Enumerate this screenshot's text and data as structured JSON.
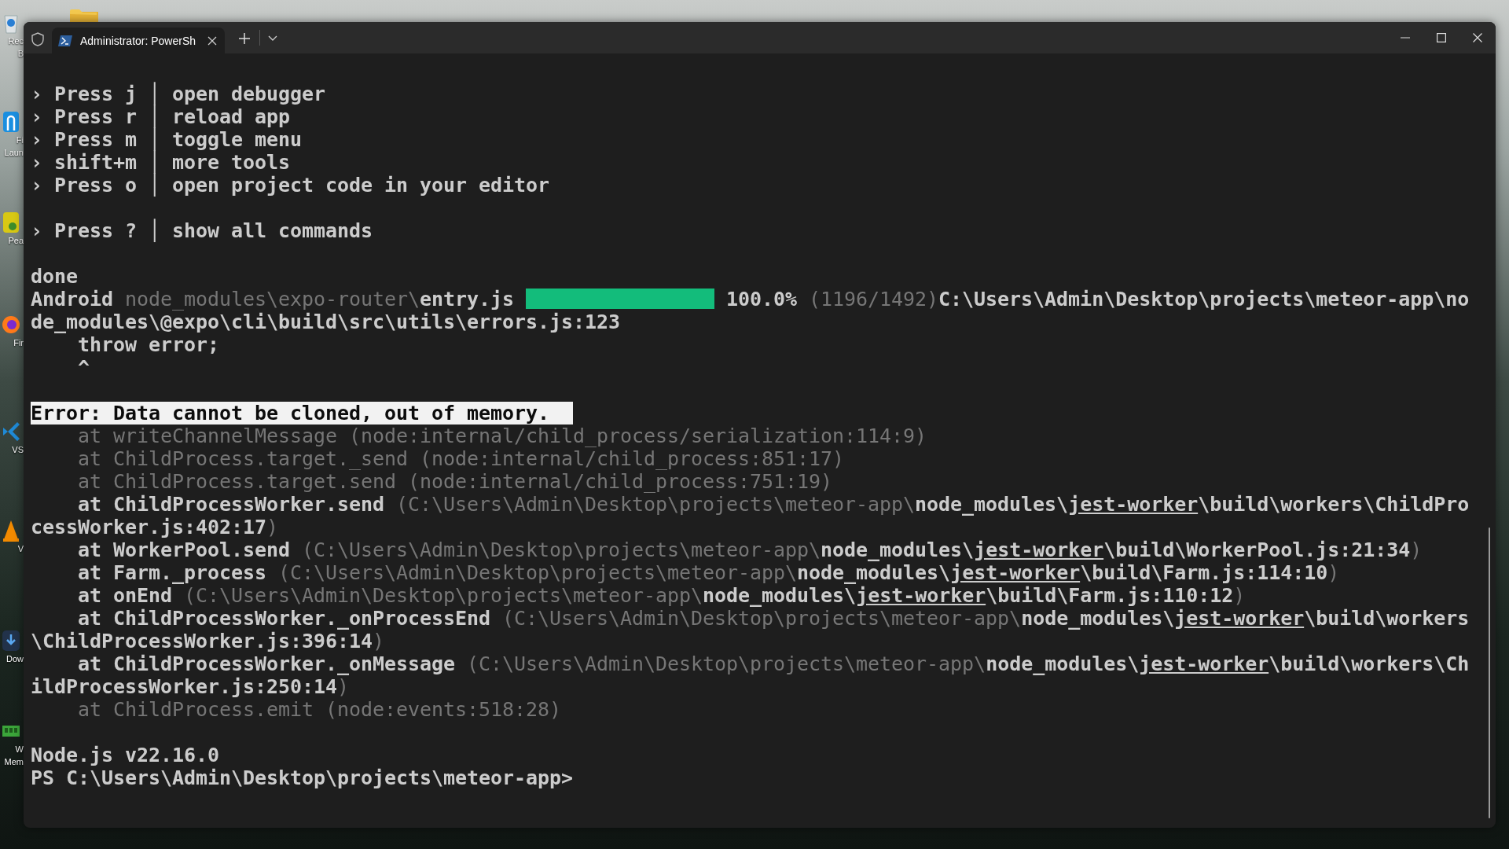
{
  "desktop": {
    "folder": {
      "kind": "folder"
    },
    "icons": [
      {
        "kind": "bin",
        "labels": [
          "Rec",
          "B"
        ]
      },
      {
        "kind": "launcher",
        "labels": [
          "Fi",
          "Laun"
        ]
      },
      {
        "kind": "pea",
        "labels": [
          "Pea"
        ]
      },
      {
        "kind": "browser",
        "labels": [
          "Fir"
        ]
      },
      {
        "kind": "code",
        "labels": [
          "VS"
        ]
      },
      {
        "kind": "cone",
        "labels": [
          "V"
        ]
      },
      {
        "kind": "download",
        "labels": [
          "Dow"
        ]
      },
      {
        "kind": "memory",
        "labels": [
          "W",
          "Mem"
        ]
      }
    ]
  },
  "window": {
    "tab": {
      "title": "Administrator: PowerSh"
    },
    "terminal": {
      "lines": [
        {
          "kind": "text",
          "segments": [
            {
              "kind": "bright",
              "text": "› Press j │ open debugger"
            }
          ]
        },
        {
          "kind": "text",
          "segments": [
            {
              "kind": "bright",
              "text": "› Press r │ reload app"
            }
          ]
        },
        {
          "kind": "text",
          "segments": [
            {
              "kind": "bright",
              "text": "› Press m │ toggle menu"
            }
          ]
        },
        {
          "kind": "text",
          "segments": [
            {
              "kind": "bright",
              "text": "› shift+m │ more tools"
            }
          ]
        },
        {
          "kind": "text",
          "segments": [
            {
              "kind": "bright",
              "text": "› Press o │ open project code in your editor"
            }
          ]
        },
        {
          "kind": "blank"
        },
        {
          "kind": "text",
          "segments": [
            {
              "kind": "bright",
              "text": "› Press ? │ show all commands"
            }
          ]
        },
        {
          "kind": "blank"
        },
        {
          "kind": "text",
          "segments": [
            {
              "kind": "bright",
              "text": "done"
            }
          ]
        },
        {
          "kind": "text",
          "segments": [
            {
              "kind": "bright",
              "text": "Android "
            },
            {
              "kind": "dim",
              "text": "node_modules\\expo-router\\"
            },
            {
              "kind": "bright",
              "text": "entry.js"
            },
            {
              "kind": "progress",
              "level": 1
            },
            {
              "kind": "bright",
              "text": "100.0%"
            },
            {
              "kind": "dim",
              "text": "(1196/1492)"
            },
            {
              "kind": "bright",
              "text": "C:\\Users\\Admin\\Desktop\\projects\\meteor-app\\no"
            }
          ]
        },
        {
          "kind": "text",
          "segments": [
            {
              "kind": "bright",
              "text": "de_modules\\@expo\\cli\\build\\src\\utils\\errors.js:123"
            }
          ]
        },
        {
          "kind": "text",
          "segments": [
            {
              "kind": "bright",
              "text": "    throw error;"
            }
          ]
        },
        {
          "kind": "text",
          "segments": [
            {
              "kind": "bright",
              "text": "    ^"
            }
          ]
        },
        {
          "kind": "blank"
        },
        {
          "kind": "text",
          "segments": [
            {
              "kind": "highlight",
              "text": "Error: Data cannot be cloned, out of memory."
            }
          ]
        },
        {
          "kind": "text",
          "segments": [
            {
              "kind": "dim",
              "text": "    at writeChannelMessage (node:internal/child_process/serialization:114:9)"
            }
          ]
        },
        {
          "kind": "text",
          "segments": [
            {
              "kind": "dim",
              "text": "    at ChildProcess.target._send (node:internal/child_process:851:17)"
            }
          ]
        },
        {
          "kind": "text",
          "segments": [
            {
              "kind": "dim",
              "text": "    at ChildProcess.target.send (node:internal/child_process:751:19)"
            }
          ]
        },
        {
          "kind": "text",
          "segments": [
            {
              "kind": "bright",
              "text": "    at ChildProcessWorker.send "
            },
            {
              "kind": "dim",
              "text": "(C:\\Users\\Admin\\Desktop\\projects\\meteor-app\\"
            },
            {
              "kind": "bright",
              "text": "node_modules\\"
            },
            {
              "kind": "link",
              "text": "jest-worker"
            },
            {
              "kind": "bright",
              "text": "\\build\\workers\\ChildPro"
            }
          ]
        },
        {
          "kind": "text",
          "segments": [
            {
              "kind": "bright",
              "text": "cessWorker.js:402:17"
            },
            {
              "kind": "dim",
              "text": ")"
            }
          ]
        },
        {
          "kind": "text",
          "segments": [
            {
              "kind": "bright",
              "text": "    at WorkerPool.send "
            },
            {
              "kind": "dim",
              "text": "(C:\\Users\\Admin\\Desktop\\projects\\meteor-app\\"
            },
            {
              "kind": "bright",
              "text": "node_modules\\"
            },
            {
              "kind": "link",
              "text": "jest-worker"
            },
            {
              "kind": "bright",
              "text": "\\build\\WorkerPool.js:21:34"
            },
            {
              "kind": "dim",
              "text": ")"
            }
          ]
        },
        {
          "kind": "text",
          "segments": [
            {
              "kind": "bright",
              "text": "    at Farm._process "
            },
            {
              "kind": "dim",
              "text": "(C:\\Users\\Admin\\Desktop\\projects\\meteor-app\\"
            },
            {
              "kind": "bright",
              "text": "node_modules\\"
            },
            {
              "kind": "link",
              "text": "jest-worker"
            },
            {
              "kind": "bright",
              "text": "\\build\\Farm.js:114:10"
            },
            {
              "kind": "dim",
              "text": ")"
            }
          ]
        },
        {
          "kind": "text",
          "segments": [
            {
              "kind": "bright",
              "text": "    at onEnd "
            },
            {
              "kind": "dim",
              "text": "(C:\\Users\\Admin\\Desktop\\projects\\meteor-app\\"
            },
            {
              "kind": "bright",
              "text": "node_modules\\"
            },
            {
              "kind": "link",
              "text": "jest-worker"
            },
            {
              "kind": "bright",
              "text": "\\build\\Farm.js:110:12"
            },
            {
              "kind": "dim",
              "text": ")"
            }
          ]
        },
        {
          "kind": "text",
          "segments": [
            {
              "kind": "bright",
              "text": "    at ChildProcessWorker._onProcessEnd "
            },
            {
              "kind": "dim",
              "text": "(C:\\Users\\Admin\\Desktop\\projects\\meteor-app\\"
            },
            {
              "kind": "bright",
              "text": "node_modules\\"
            },
            {
              "kind": "link",
              "text": "jest-worker"
            },
            {
              "kind": "bright",
              "text": "\\build\\workers"
            }
          ]
        },
        {
          "kind": "text",
          "segments": [
            {
              "kind": "bright",
              "text": "\\ChildProcessWorker.js:396:14"
            },
            {
              "kind": "dim",
              "text": ")"
            }
          ]
        },
        {
          "kind": "text",
          "segments": [
            {
              "kind": "bright",
              "text": "    at ChildProcessWorker._onMessage "
            },
            {
              "kind": "dim",
              "text": "(C:\\Users\\Admin\\Desktop\\projects\\meteor-app\\"
            },
            {
              "kind": "bright",
              "text": "node_modules\\"
            },
            {
              "kind": "link",
              "text": "jest-worker"
            },
            {
              "kind": "bright",
              "text": "\\build\\workers\\Ch"
            }
          ]
        },
        {
          "kind": "text",
          "segments": [
            {
              "kind": "bright",
              "text": "ildProcessWorker.js:250:14"
            },
            {
              "kind": "dim",
              "text": ")"
            }
          ]
        },
        {
          "kind": "text",
          "segments": [
            {
              "kind": "dim",
              "text": "    at ChildProcess.emit (node:events:518:28)"
            }
          ]
        },
        {
          "kind": "blank"
        },
        {
          "kind": "text",
          "segments": [
            {
              "kind": "bright",
              "text": "Node.js v22.16.0"
            }
          ]
        },
        {
          "kind": "text",
          "segments": [
            {
              "kind": "bright",
              "text": "PS C:\\Users\\Admin\\Desktop\\projects\\meteor-app>"
            }
          ]
        }
      ]
    }
  }
}
